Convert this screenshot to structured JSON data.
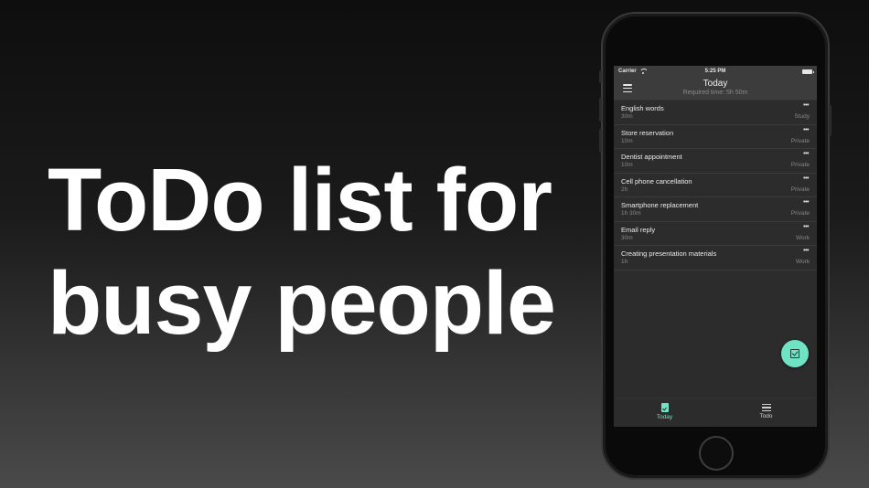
{
  "headline": {
    "line1": "ToDo list for",
    "line2": "busy people"
  },
  "status_bar": {
    "carrier": "Carrier",
    "time": "5:25 PM"
  },
  "nav": {
    "title": "Today",
    "subtitle": "Required time: 5h 50m",
    "menu_icon": "hamburger-menu-icon"
  },
  "tasks": [
    {
      "title": "English words",
      "duration": "30m",
      "category": "Study",
      "more": "•••"
    },
    {
      "title": "Store reservation",
      "duration": "10m",
      "category": "Private",
      "more": "•••"
    },
    {
      "title": "Dentist appointment",
      "duration": "10m",
      "category": "Private",
      "more": "•••"
    },
    {
      "title": "Cell phone cancellation",
      "duration": "2h",
      "category": "Private",
      "more": "•••"
    },
    {
      "title": "Smartphone replacement",
      "duration": "1h 30m",
      "category": "Private",
      "more": "•••"
    },
    {
      "title": "Email reply",
      "duration": "30m",
      "category": "Work",
      "more": "•••"
    },
    {
      "title": "Creating presentation materials",
      "duration": "1h",
      "category": "Work",
      "more": "•••"
    }
  ],
  "fab": {
    "icon": "checkbox-icon"
  },
  "tab_bar": {
    "today_label": "Today",
    "todo_label": "Todo"
  },
  "colors": {
    "accent": "#6fe3c4",
    "screen_bg": "#2c2c2c",
    "nav_bg": "#3c3c3c"
  }
}
